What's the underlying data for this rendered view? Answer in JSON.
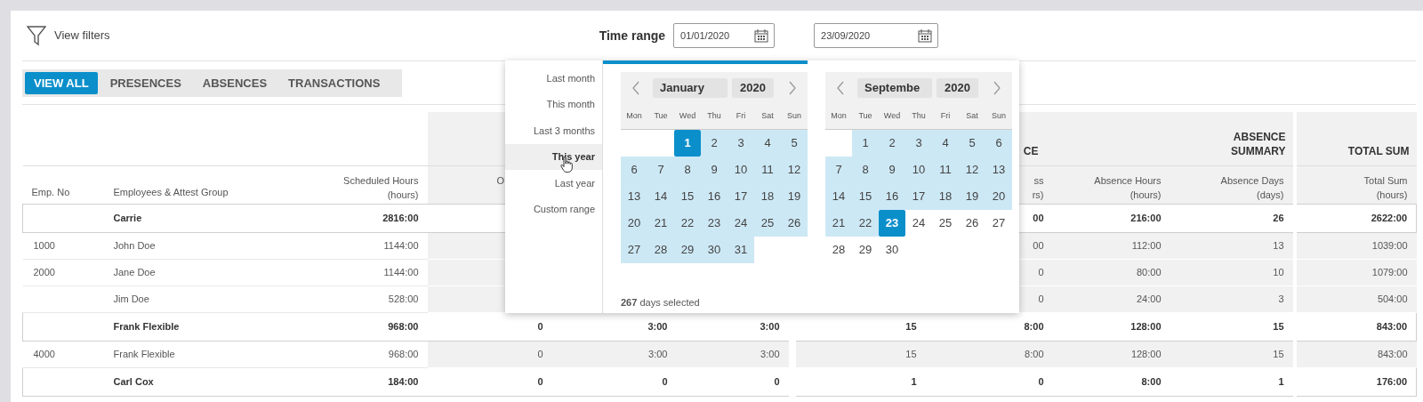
{
  "filters": {
    "label": "View filters"
  },
  "time_range": {
    "label": "Time range",
    "from": "01/01/2020",
    "to": "23/09/2020"
  },
  "tabs": [
    {
      "label": "VIEW ALL",
      "selected": true
    },
    {
      "label": "PRESENCES",
      "selected": false
    },
    {
      "label": "ABSENCES",
      "selected": false
    },
    {
      "label": "TRANSACTIONS",
      "selected": false
    }
  ],
  "table": {
    "column_groups": [
      "CE",
      "ABSENCE SUMMARY",
      "TOTAL SUM"
    ],
    "columns": [
      "Emp. No",
      "Employees & Attest Group",
      "Scheduled Hours\n(hours)",
      "O",
      null,
      null,
      null,
      "ss\nrs)",
      "Absence Hours\n(hours)",
      "Absence Days\n(days)",
      "Total Sum\n(hours)"
    ],
    "rows": [
      {
        "kind": "group",
        "cells": [
          null,
          "Carrie",
          "2816:00",
          null,
          null,
          null,
          null,
          "00",
          "216:00",
          "26",
          "2622:00"
        ]
      },
      {
        "kind": "employee",
        "cells": [
          "1000",
          "John Doe",
          "1144:00",
          null,
          null,
          null,
          null,
          "00",
          "112:00",
          "13",
          "1039:00"
        ]
      },
      {
        "kind": "employee",
        "cells": [
          "2000",
          "Jane Doe",
          "1144:00",
          null,
          null,
          null,
          null,
          "0",
          "80:00",
          "10",
          "1079:00"
        ]
      },
      {
        "kind": "employee",
        "cells": [
          null,
          "Jim Doe",
          "528:00",
          null,
          null,
          null,
          null,
          "0",
          "24:00",
          "3",
          "504:00"
        ]
      },
      {
        "kind": "group",
        "cells": [
          null,
          "Frank Flexible",
          "968:00",
          "0",
          "3:00",
          "3:00",
          "15",
          "8:00",
          "128:00",
          "15",
          "843:00"
        ]
      },
      {
        "kind": "employee",
        "cells": [
          "4000",
          "Frank Flexible",
          "968:00",
          "0",
          "3:00",
          "3:00",
          "15",
          "8:00",
          "128:00",
          "15",
          "843:00"
        ]
      },
      {
        "kind": "group",
        "cells": [
          null,
          "Carl Cox",
          "184:00",
          "0",
          "0",
          "0",
          "1",
          "0",
          "8:00",
          "1",
          "176:00"
        ]
      }
    ]
  },
  "date_picker": {
    "presets": [
      {
        "label": "Last month",
        "selected": false
      },
      {
        "label": "This month",
        "selected": false
      },
      {
        "label": "Last 3 months",
        "selected": false
      },
      {
        "label": "This year",
        "selected": true
      },
      {
        "label": "Last year",
        "selected": false
      },
      {
        "label": "Custom range",
        "selected": false
      }
    ],
    "calendars": [
      {
        "month": "January",
        "year": "2020",
        "weekdays": [
          "Mon",
          "Tue",
          "Wed",
          "Thu",
          "Fri",
          "Sat",
          "Sun"
        ],
        "days": [
          {
            "kind": "blank"
          },
          {
            "kind": "blank"
          },
          {
            "day": "1",
            "kind": "endpoint"
          },
          {
            "day": "2",
            "kind": "in_range"
          },
          {
            "day": "3",
            "kind": "in_range"
          },
          {
            "day": "4",
            "kind": "in_range"
          },
          {
            "day": "5",
            "kind": "in_range"
          },
          {
            "day": "6",
            "kind": "in_range"
          },
          {
            "day": "7",
            "kind": "in_range"
          },
          {
            "day": "8",
            "kind": "in_range"
          },
          {
            "day": "9",
            "kind": "in_range"
          },
          {
            "day": "10",
            "kind": "in_range"
          },
          {
            "day": "11",
            "kind": "in_range"
          },
          {
            "day": "12",
            "kind": "in_range"
          },
          {
            "day": "13",
            "kind": "in_range"
          },
          {
            "day": "14",
            "kind": "in_range"
          },
          {
            "day": "15",
            "kind": "in_range"
          },
          {
            "day": "16",
            "kind": "in_range"
          },
          {
            "day": "17",
            "kind": "in_range"
          },
          {
            "day": "18",
            "kind": "in_range"
          },
          {
            "day": "19",
            "kind": "in_range"
          },
          {
            "day": "20",
            "kind": "in_range"
          },
          {
            "day": "21",
            "kind": "in_range"
          },
          {
            "day": "22",
            "kind": "in_range"
          },
          {
            "day": "23",
            "kind": "in_range"
          },
          {
            "day": "24",
            "kind": "in_range"
          },
          {
            "day": "25",
            "kind": "in_range"
          },
          {
            "day": "26",
            "kind": "in_range"
          },
          {
            "day": "27",
            "kind": "in_range"
          },
          {
            "day": "28",
            "kind": "in_range"
          },
          {
            "day": "29",
            "kind": "in_range"
          },
          {
            "day": "30",
            "kind": "in_range"
          },
          {
            "day": "31",
            "kind": "in_range"
          }
        ]
      },
      {
        "month": "Septembe",
        "year": "2020",
        "weekdays": [
          "Mon",
          "Tue",
          "Wed",
          "Thu",
          "Fri",
          "Sat",
          "Sun"
        ],
        "days": [
          {
            "kind": "blank"
          },
          {
            "day": "1",
            "kind": "in_range"
          },
          {
            "day": "2",
            "kind": "in_range"
          },
          {
            "day": "3",
            "kind": "in_range"
          },
          {
            "day": "4",
            "kind": "in_range"
          },
          {
            "day": "5",
            "kind": "in_range"
          },
          {
            "day": "6",
            "kind": "in_range"
          },
          {
            "day": "7",
            "kind": "in_range"
          },
          {
            "day": "8",
            "kind": "in_range"
          },
          {
            "day": "9",
            "kind": "in_range"
          },
          {
            "day": "10",
            "kind": "in_range"
          },
          {
            "day": "11",
            "kind": "in_range"
          },
          {
            "day": "12",
            "kind": "in_range"
          },
          {
            "day": "13",
            "kind": "in_range"
          },
          {
            "day": "14",
            "kind": "in_range"
          },
          {
            "day": "15",
            "kind": "in_range"
          },
          {
            "day": "16",
            "kind": "in_range"
          },
          {
            "day": "17",
            "kind": "in_range"
          },
          {
            "day": "18",
            "kind": "in_range"
          },
          {
            "day": "19",
            "kind": "in_range"
          },
          {
            "day": "20",
            "kind": "in_range"
          },
          {
            "day": "21",
            "kind": "in_range"
          },
          {
            "day": "22",
            "kind": "in_range"
          },
          {
            "day": "23",
            "kind": "endpoint"
          },
          {
            "day": "24",
            "kind": "out"
          },
          {
            "day": "25",
            "kind": "out"
          },
          {
            "day": "26",
            "kind": "out"
          },
          {
            "day": "27",
            "kind": "out"
          },
          {
            "day": "28",
            "kind": "out"
          },
          {
            "day": "29",
            "kind": "out"
          },
          {
            "day": "30",
            "kind": "out"
          }
        ]
      }
    ],
    "summary": "**267** days selected"
  }
}
